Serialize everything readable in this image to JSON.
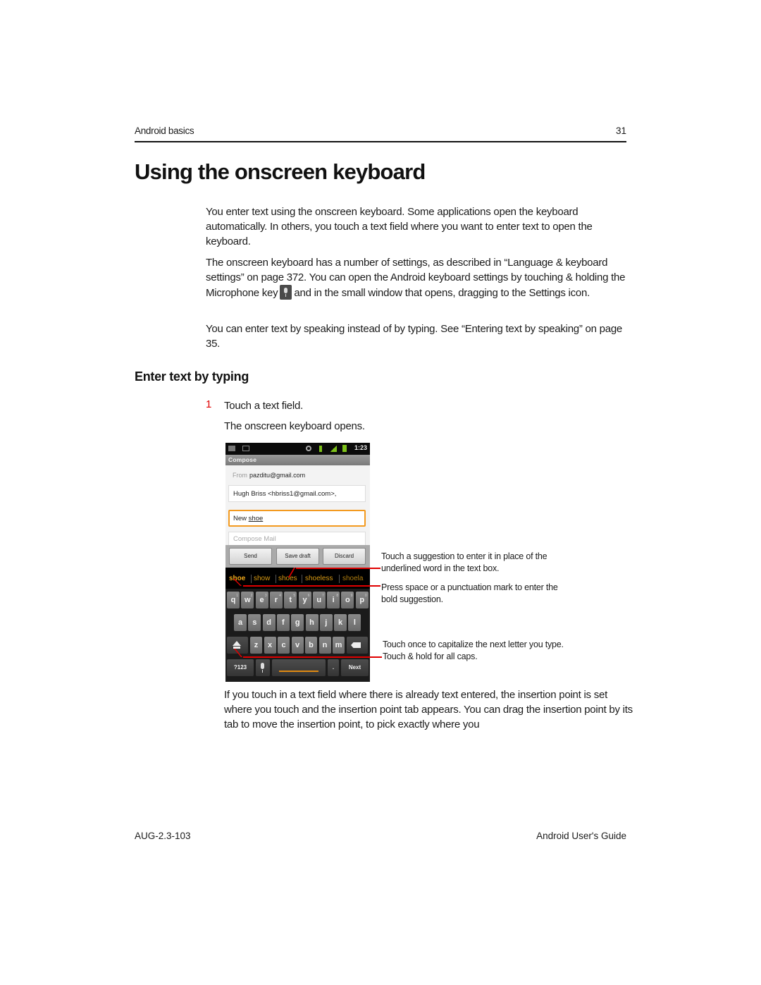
{
  "header": {
    "section": "Android basics",
    "page_number": "31"
  },
  "title": "Using the onscreen keyboard",
  "paragraphs": {
    "p1": "You enter text using the onscreen keyboard. Some applications open the keyboard automatically. In others, you touch a text field where you want to enter text to open the keyboard.",
    "p2_before_icon": "The onscreen keyboard has a number of settings, as described in “Language & keyboard settings” on page 372. You can open the Android keyboard settings by touching & holding the Microphone key",
    "p2_after_icon": "and in the small window that opens, dragging to the Settings icon.",
    "p3": "You can enter text by speaking instead of by typing. See “Entering text by speaking” on page 35.",
    "p4": "If you touch in a text field where there is already text entered, the insertion point is set where you touch and the insertion point tab appears. You can drag the insertion point by its tab to move the insertion point, to pick exactly where you"
  },
  "subsection": {
    "title": "Enter text by typing",
    "steps": [
      {
        "number": "1",
        "text": "Touch a text field.",
        "note": "The onscreen keyboard opens."
      }
    ],
    "accent_color": "#e00000"
  },
  "phone": {
    "status_time": "1:23",
    "app_title": "Compose",
    "from_label": "From",
    "from_value": "pazditu@gmail.com",
    "to_value": "Hugh Briss <hbriss1@gmail.com>,",
    "subject_prefix": "New ",
    "subject_underlined": "shoe",
    "body_placeholder": "Compose Mail",
    "buttons": [
      "Send",
      "Save draft",
      "Discard"
    ],
    "suggestions": [
      "shoe",
      "show",
      "shoes",
      "shoeless",
      "shoela"
    ],
    "keyboard": {
      "row1": [
        {
          "k": "q",
          "h": "1"
        },
        {
          "k": "w",
          "h": "2"
        },
        {
          "k": "e",
          "h": "3"
        },
        {
          "k": "r",
          "h": "4"
        },
        {
          "k": "t",
          "h": "5"
        },
        {
          "k": "y",
          "h": "6"
        },
        {
          "k": "u",
          "h": "7"
        },
        {
          "k": "i",
          "h": "8"
        },
        {
          "k": "o",
          "h": "9"
        },
        {
          "k": "p",
          "h": "0"
        }
      ],
      "row2": [
        "a",
        "s",
        "d",
        "f",
        "g",
        "h",
        "j",
        "k",
        "l"
      ],
      "row3": [
        "z",
        "x",
        "c",
        "v",
        "b",
        "n",
        "m"
      ],
      "symbols_key": "?123",
      "period_key": ".",
      "next_key": "Next"
    },
    "accent_color": "#f39a1f"
  },
  "callouts": {
    "suggestion": "Touch a suggestion to enter it in place of the underlined word in the text box.",
    "space": "Press space or a punctuation mark to enter the bold suggestion.",
    "shift": "Touch once to capitalize the next letter you type. Touch & hold for all caps.",
    "line_color": "#e00000"
  },
  "footer": {
    "doc_id": "AUG-2.3-103",
    "guide_title": "Android User's Guide"
  }
}
